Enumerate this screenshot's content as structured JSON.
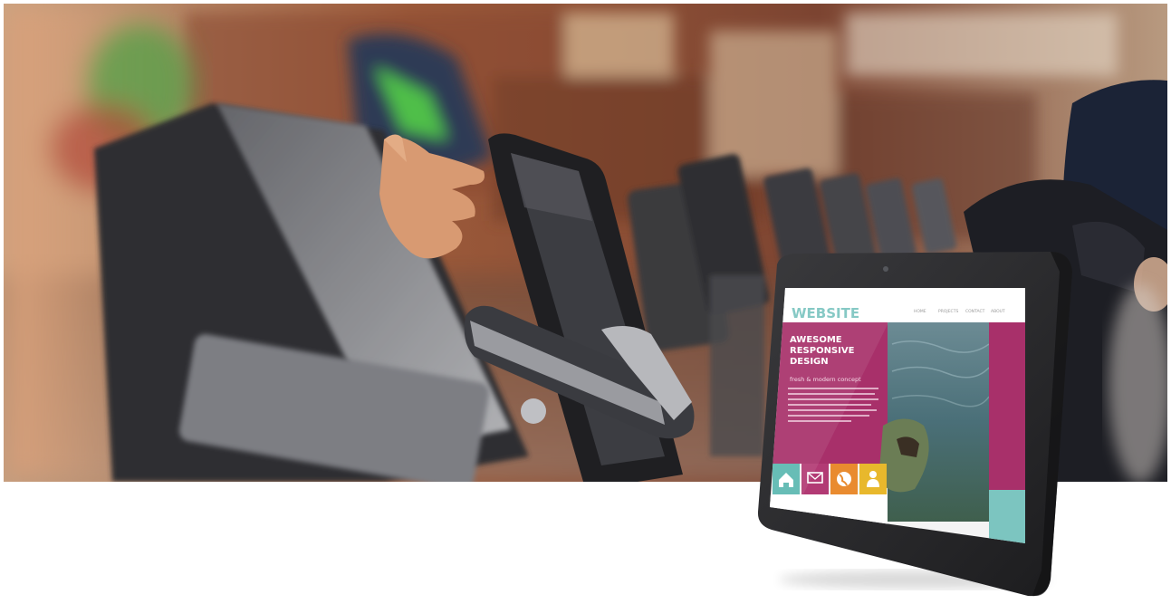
{
  "photo": {
    "subject": "customers using self-service tablet kiosks",
    "colors": {
      "brick": "#7a3f2a",
      "warm_wall": "#c98d5b",
      "skin": "#d89a72",
      "device_dark": "#2b2b2e",
      "device_grey": "#8c8d92"
    }
  },
  "tablet_screen": {
    "logo": "WEBSITE",
    "nav": [
      "HOME",
      "PROJECTS",
      "CONTACT",
      "ABOUT"
    ],
    "headline": [
      "AWESOME",
      "RESPONSIVE",
      "DESIGN"
    ],
    "tagline": "fresh & modern concept",
    "tiles": [
      {
        "icon": "home-icon",
        "color": "#5bb8b0"
      },
      {
        "icon": "mail-icon",
        "color": "#b23a74"
      },
      {
        "icon": "globe-icon",
        "color": "#e98b2f"
      },
      {
        "icon": "user-icon",
        "color": "#e8b82c"
      }
    ],
    "colors": {
      "magenta": "#a8306a",
      "teal": "#7cc5c0",
      "bezel": "#2a2a2c",
      "water": "#4f7a86"
    }
  }
}
